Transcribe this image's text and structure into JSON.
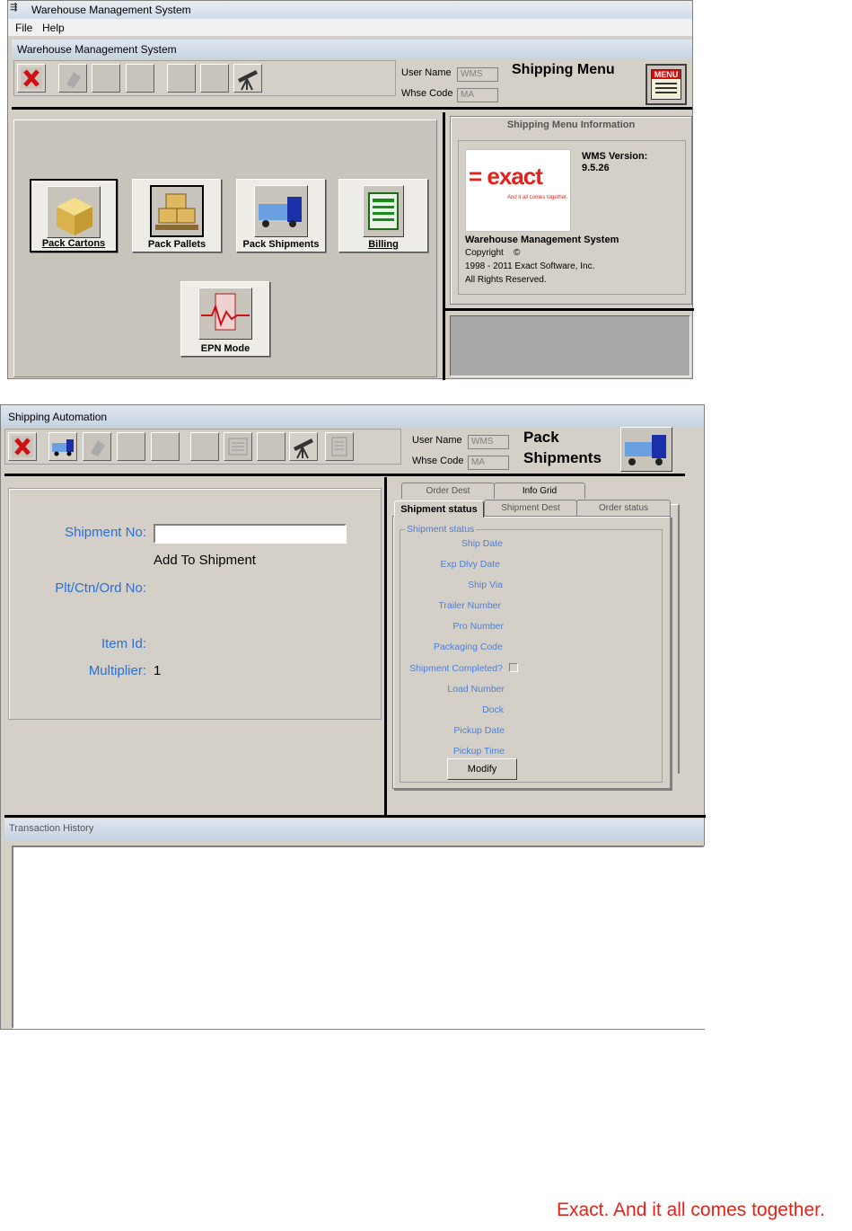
{
  "menu_window": {
    "os_title": "Warehouse Management System",
    "menubar": [
      "File",
      "Help"
    ],
    "window_title": "Warehouse Management System",
    "user_name_label": "User Name",
    "user_name_value": "WMS",
    "whse_code_label": "Whse Code",
    "whse_code_value": "MA",
    "screen_title": "Shipping Menu",
    "menu_icon_text": "MENU",
    "buttons": [
      {
        "label": "Pack Cartons",
        "icon": "box-icon"
      },
      {
        "label": "Pack Pallets",
        "icon": "pallet-icon"
      },
      {
        "label": "Pack Shipments",
        "icon": "truck-icon"
      },
      {
        "label": "Billing",
        "icon": "billing-icon"
      },
      {
        "label": "EPN Mode",
        "icon": "epn-icon"
      }
    ],
    "info_panel": {
      "title": "Shipping Menu Information",
      "logo_text": "= exact",
      "logo_tagline": "And it all comes together.",
      "version_label": "WMS Version:",
      "version_value": "9.5.26",
      "product_name": "Warehouse Management System",
      "copyright_label": "Copyright",
      "copyright_symbol": "©",
      "copyright_years": "1998 - 2011  Exact Software, Inc.",
      "rights": "All Rights Reserved."
    }
  },
  "shipping_window": {
    "window_title": "Shipping Automation",
    "user_name_label": "User Name",
    "user_name_value": "WMS",
    "whse_code_label": "Whse Code",
    "whse_code_value": "MA",
    "screen_title_line1": "Pack",
    "screen_title_line2": "Shipments",
    "form": {
      "shipment_no_label": "Shipment No:",
      "shipment_no_value": "",
      "add_to_shipment": "Add To Shipment",
      "plt_label": "Plt/Ctn/Ord No:",
      "item_id_label": "Item Id:",
      "multiplier_label": "Multiplier:",
      "multiplier_value": "1"
    },
    "tabs_row1": [
      "Order Dest",
      "Info Grid"
    ],
    "tabs_row2": [
      "Shipment status",
      "Shipment Dest",
      "Order status"
    ],
    "active_tab": "Shipment status",
    "group_title": "Shipment status",
    "status_fields": [
      "Ship Date",
      "Exp Dlvy Date",
      "Ship Via",
      "Trailer Number",
      "Pro Number",
      "Packaging Code",
      "Shipment Completed?",
      "Load Number",
      "Dock",
      "Pickup Date",
      "Pickup Time"
    ],
    "modify_button": "Modify",
    "transaction_history_title": "Transaction History"
  },
  "footer": {
    "tagline": "Exact. And it all comes together.",
    "tagline_color": "#e2231a"
  }
}
